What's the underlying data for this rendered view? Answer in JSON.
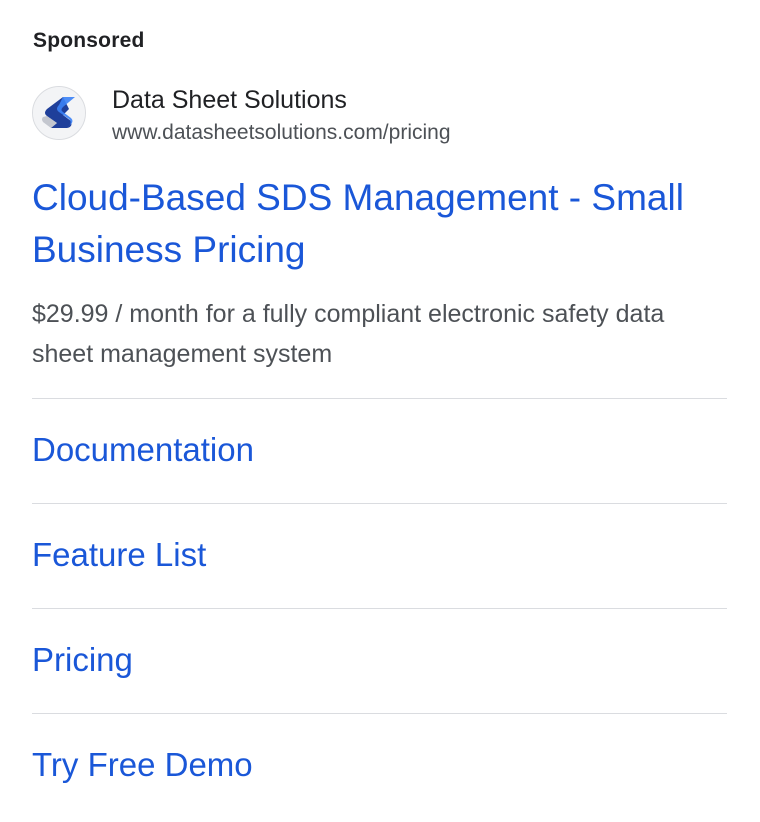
{
  "sponsored_label": "Sponsored",
  "advertiser": {
    "name": "Data Sheet Solutions",
    "url": "www.datasheetsolutions.com/pricing",
    "favicon_icon": "data-sheet-solutions-logo-icon"
  },
  "ad": {
    "headline": "Cloud-Based SDS Management - Small Business Pricing",
    "description": "$29.99 / month for a fully compliant electronic safety data sheet management system"
  },
  "sitelinks": [
    {
      "label": "Documentation"
    },
    {
      "label": "Feature List"
    },
    {
      "label": "Pricing"
    },
    {
      "label": "Try Free Demo"
    }
  ],
  "colors": {
    "link": "#1a57d8",
    "text_primary": "#202124",
    "text_secondary": "#4d5156",
    "divider": "#dadce0"
  }
}
